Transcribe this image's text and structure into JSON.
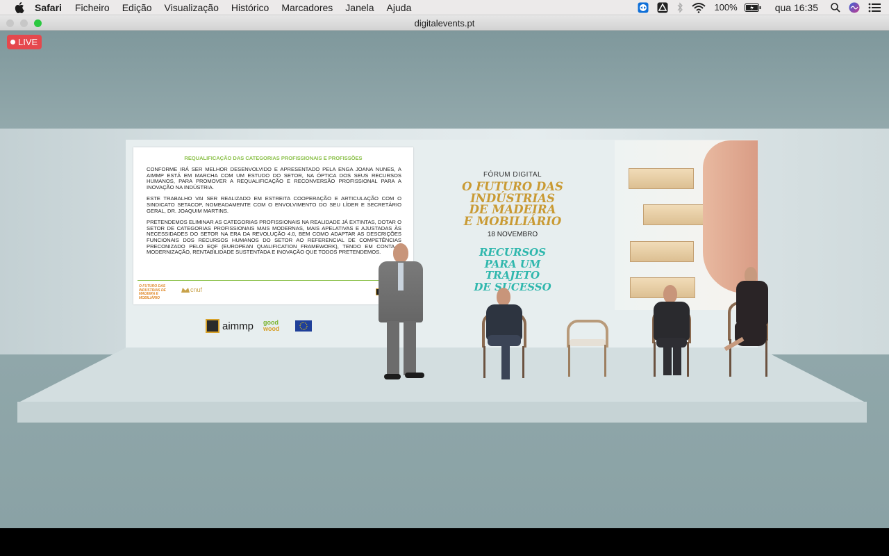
{
  "menubar": {
    "app": "Safari",
    "items": [
      "Ficheiro",
      "Edição",
      "Visualização",
      "Histórico",
      "Marcadores",
      "Janela",
      "Ajuda"
    ],
    "battery": "100%",
    "clock": "qua 16:35",
    "icons": [
      "apple-icon",
      "teamviewer-icon",
      "drive-icon",
      "bluetooth-icon",
      "wifi-icon",
      "battery-icon",
      "spotlight-icon",
      "siri-icon",
      "control-center-icon"
    ]
  },
  "window": {
    "title": "digitalevents.pt"
  },
  "live_badge": "LIVE",
  "slide": {
    "title": "REQUALIFICAÇÃO DAS CATEGORIAS PROFISSIONAIS E PROFISSÕES",
    "paragraphs": [
      "CONFORME IRÁ SER MELHOR DESENVOLVIDO E APRESENTADO PELA ENGA JOANA NUNES, A AIMMP ESTÁ EM MARCHA COM UM ESTUDO DO SETOR, NA ÓPTICA DOS SEUS RECURSOS HUMANOS, PARA PROMOVER A REQUALIFICAÇÃO E RECONVERSÃO PROFISSIONAL PARA A INOVAÇÃO NA INDÚSTRIA.",
      "ESTE TRABALHO VAI SER REALIZADO EM ESTREITA COOPERAÇÃO E ARTICULAÇÃO COM O SINDICATO SETACOP, NOMEADAMENTE COM O ENVOLVIMENTO DO SEU LÍDER E SECRETÁRIO GERAL, DR. JOAQUIM MARTINS.",
      "PRETENDEMOS ELIMINAR AS CATEGORIAS PROFISSIONAIS NA REALIDADE JÁ EXTINTAS, DOTAR O SETOR DE CATEGORIAS PROFISSIONAIS MAIS MODERNAS, MAIS APELATIVAS E AJUSTADAS ÀS NECESSIDADES DO SETOR NA ERA DA REVOLUÇÃO 4.0, BEM COMO ADAPTAR AS DESCRIÇÕES FUNCIONAIS DOS RECURSOS HUMANOS DO SETOR AO REFERENCIAL DE COMPETÊNCIAS PRECONIZADO PELO EQF (EUROPEAN QUALIFICATION FRAMEWORK), TENDO EM CONTA A MODERNIZAÇÃO, RENTABILIDADE SUSTENTADA E INOVAÇÃO QUE TODOS PRETENDEMOS."
    ],
    "footer_forum": "O FUTURO DAS INDÚSTRIAS DE MADEIRA E MOBILIÁRIO",
    "footer_cnuf": "cnuf",
    "footer_aimmp": "aimmp"
  },
  "logos": {
    "aimmp": "aimmp",
    "goodwood_1": "good",
    "goodwood_2": "wood"
  },
  "poster": {
    "label": "FÓRUM DIGITAL",
    "title_lines": [
      "O FUTURO DAS",
      "INDÚSTRIAS",
      "DE MADEIRA",
      "E MOBILIÁRIO"
    ],
    "date": "18 NOVEMBRO",
    "tagline_lines": [
      "RECURSOS",
      "PARA UM",
      "TRAJETO",
      "DE SUCESSO"
    ]
  },
  "colors": {
    "live": "#e5484d",
    "slide_title": "#8cc14b",
    "poster_gold": "#c99a33",
    "poster_teal": "#2fb7ad"
  }
}
